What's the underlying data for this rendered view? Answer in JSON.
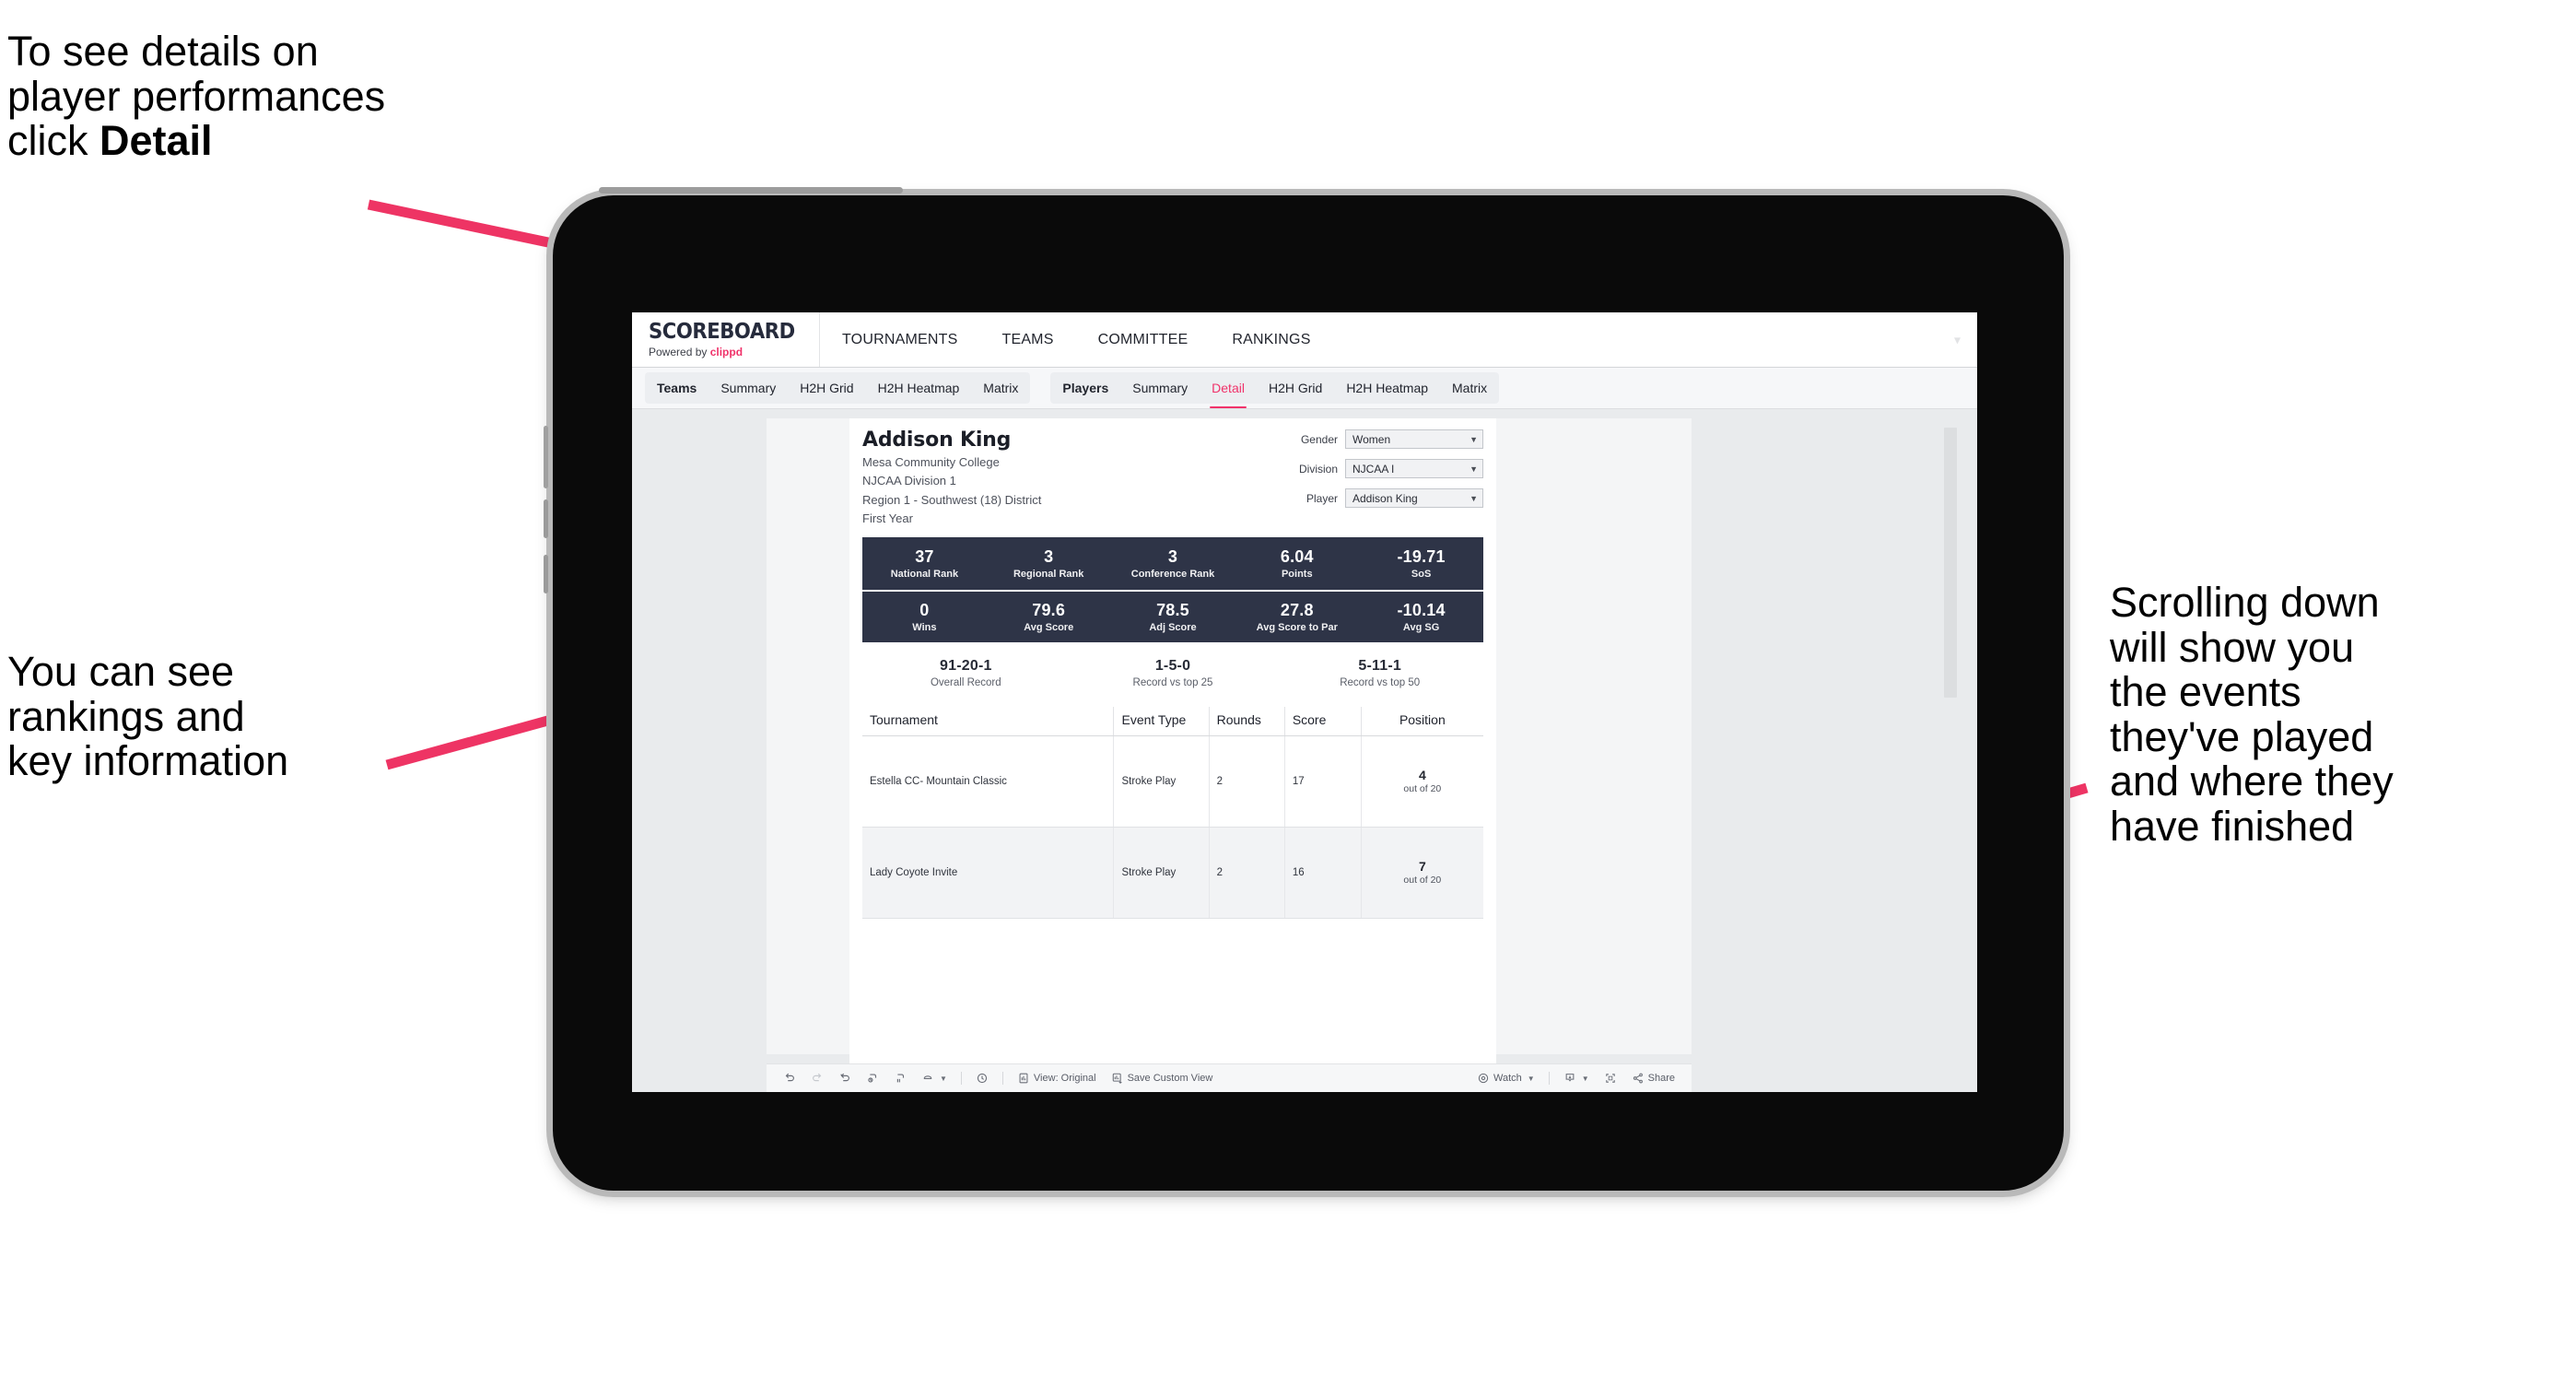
{
  "annotations": {
    "detail": "To see details on\nplayer performances\nclick ",
    "detail_bold": "Detail",
    "rankings": "You can see\nrankings and\nkey information",
    "scroll": "Scrolling down\nwill show you\nthe events\nthey've played\nand where they\nhave finished"
  },
  "colors": {
    "accent_pink": "#f0326a",
    "band_navy": "#2e3447",
    "arrow_pink": "#ee3464"
  },
  "topnav": {
    "brand_title": "SCOREBOARD",
    "brand_sub_prefix": "Powered by ",
    "brand_sub_brand": "clippd",
    "links": [
      "TOURNAMENTS",
      "TEAMS",
      "COMMITTEE",
      "RANKINGS"
    ],
    "chevron": "chevron-down-icon"
  },
  "subnav": {
    "group_teams": [
      "Teams",
      "Summary",
      "H2H Grid",
      "H2H Heatmap",
      "Matrix"
    ],
    "group_players": [
      "Players",
      "Summary",
      "Detail",
      "H2H Grid",
      "H2H Heatmap",
      "Matrix"
    ],
    "active_tab": "Detail"
  },
  "player": {
    "name": "Addison King",
    "school": "Mesa Community College",
    "division": "NJCAA Division 1",
    "region": "Region 1 - Southwest (18) District",
    "year": "First Year"
  },
  "filters": [
    {
      "label": "Gender",
      "value": "Women"
    },
    {
      "label": "Division",
      "value": "NJCAA I"
    },
    {
      "label": "Player",
      "value": "Addison King"
    }
  ],
  "stats_row1": [
    {
      "value": "37",
      "label": "National Rank"
    },
    {
      "value": "3",
      "label": "Regional Rank"
    },
    {
      "value": "3",
      "label": "Conference Rank"
    },
    {
      "value": "6.04",
      "label": "Points"
    },
    {
      "value": "-19.71",
      "label": "SoS"
    }
  ],
  "stats_row2": [
    {
      "value": "0",
      "label": "Wins"
    },
    {
      "value": "79.6",
      "label": "Avg Score"
    },
    {
      "value": "78.5",
      "label": "Adj Score"
    },
    {
      "value": "27.8",
      "label": "Avg Score to Par"
    },
    {
      "value": "-10.14",
      "label": "Avg SG"
    }
  ],
  "records": [
    {
      "value": "91-20-1",
      "label": "Overall Record"
    },
    {
      "value": "1-5-0",
      "label": "Record vs top 25"
    },
    {
      "value": "5-11-1",
      "label": "Record vs top 50"
    }
  ],
  "events_table": {
    "columns": [
      "Tournament",
      "Event Type",
      "Rounds",
      "Score",
      "Position"
    ],
    "rows": [
      {
        "tournament": "Estella CC- Mountain Classic",
        "event_type": "Stroke Play",
        "rounds": "2",
        "score": "17",
        "position_number": "4",
        "position_outof": "out of 20"
      },
      {
        "tournament": "Lady Coyote Invite",
        "event_type": "Stroke Play",
        "rounds": "2",
        "score": "16",
        "position_number": "7",
        "position_outof": "out of 20"
      }
    ]
  },
  "toolbar": {
    "undo": "undo-icon",
    "redo": "redo-icon",
    "revert": "revert-icon",
    "refresh": "refresh-data-icon",
    "pause": "pause-updates-icon",
    "highlight": "highlight-icon",
    "alert": "alert-icon",
    "view_label": "View: Original",
    "save_label": "Save Custom View",
    "watch_label": "Watch",
    "download": "download-icon",
    "fullscreen": "fullscreen-icon",
    "share_label": "Share"
  }
}
